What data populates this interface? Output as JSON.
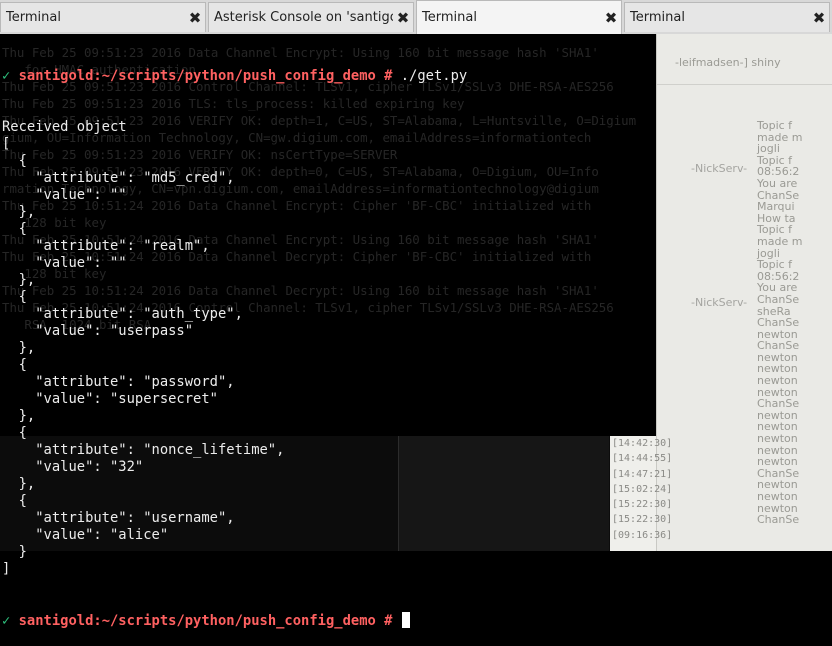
{
  "tabs": [
    {
      "label": "Terminal",
      "active": false,
      "close_icon": "close-icon"
    },
    {
      "label": "Asterisk Console on 'santigol",
      "active": false,
      "close_icon": "close-icon"
    },
    {
      "label": "Terminal",
      "active": true,
      "close_icon": "close-icon"
    },
    {
      "label": "Terminal",
      "active": false,
      "close_icon": "close-icon"
    }
  ],
  "tab_close_glyph": "✖",
  "colors": {
    "terminal_bg": "#000000",
    "prompt_mark": "#2ec27e",
    "prompt_text": "#ff6161",
    "output_text": "#ececec"
  },
  "terminal": {
    "prompt_mark": "✓",
    "prompt": "santigold:~/scripts/python/push_config_demo #",
    "command": "./get.py",
    "output": [
      "Received object",
      "[",
      "  {",
      "    \"attribute\": \"md5_cred\",",
      "    \"value\": \"\"",
      "  },",
      "  {",
      "    \"attribute\": \"realm\",",
      "    \"value\": \"\"",
      "  },",
      "  {",
      "    \"attribute\": \"auth_type\",",
      "    \"value\": \"userpass\"",
      "  },",
      "  {",
      "    \"attribute\": \"password\",",
      "    \"value\": \"supersecret\"",
      "  },",
      "  {",
      "    \"attribute\": \"nonce_lifetime\",",
      "    \"value\": \"32\"",
      "  },",
      "  {",
      "    \"attribute\": \"username\",",
      "    \"value\": \"alice\"",
      "  }",
      "]"
    ],
    "final_prompt_mark": "✓",
    "final_prompt": "santigold:~/scripts/python/push_config_demo #"
  },
  "background_console": {
    "lines": [
      "Thu Feb 25 09:51:23 2016 Data Channel Encrypt: Using 160 bit message hash 'SHA1'",
      "   for HMAC authentication",
      "Thu Feb 25 09:51:23 2016 Control Channel: TLSv1, cipher TLSv1/SSLv3 DHE-RSA-AES256",
      "",
      "Thu Feb 25 09:51:23 2016 TLS: tls_process: killed expiring key",
      "Thu Feb 25 09:51:23 2016 VERIFY OK: depth=1, C=US, ST=Alabama, L=Huntsville, O=Digium",
      "gium, OU=Information Technology, CN=gw.digium.com, emailAddress=informationtech",
      "",
      "Thu Feb 25 09:51:23 2016 VERIFY OK: nsCertType=SERVER",
      "Thu Feb 25 09:51:23 2016 VERIFY OK: depth=0, C=US, ST=Alabama, O=Digium, OU=Info",
      "rmation Technology, CN=vpn.digium.com, emailAddress=informationtechnology@digium",
      "",
      "Thu Feb 25 10:51:24 2016 Data Channel Encrypt: Cipher 'BF-CBC' initialized with",
      "   128 bit key",
      "Thu Feb 25 10:51:24 2016 Data Channel Encrypt: Using 160 bit message hash 'SHA1'",
      "",
      "Thu Feb 25 10:51:24 2016 Data Channel Decrypt: Cipher 'BF-CBC' initialized with",
      "   128 bit key",
      "Thu Feb 25 10:51:24 2016 Data Channel Decrypt: Using 160 bit message hash 'SHA1'",
      "",
      "Thu Feb 25 10:51:24 2016 Control Channel: TLSv1, cipher TLSv1/SSLv3 DHE-RSA-AES256",
      "   RSA, 1024 bit RSA"
    ]
  },
  "background_chat": {
    "channel_line": "-leifmadsen-] shiny",
    "nicks": [
      "-NickServ-",
      "-NickServ-"
    ],
    "messages": [
      "Topic f",
      "made m",
      "jogli",
      "Topic f",
      "08:56:2",
      "You are",
      "ChanSe",
      "Marqui",
      "How ta",
      "Topic f",
      "made m",
      "jogli",
      "Topic f",
      "08:56:2",
      "You are",
      "ChanSe",
      "sheRa",
      "ChanSe",
      "newton",
      "ChanSe",
      "newton",
      "newton",
      "newton",
      "newton",
      "ChanSe",
      "newton",
      "newton",
      "newton",
      "newton",
      "newton",
      "ChanSe",
      "newton",
      "newton",
      "newton",
      "ChanSe"
    ],
    "timestamps": [
      "[14:42:30]",
      "[14:44:55]",
      "[14:47:21]",
      "[15:02:24]",
      "[15:22:30]",
      "[15:22:30]",
      "[09:16:36]"
    ]
  }
}
